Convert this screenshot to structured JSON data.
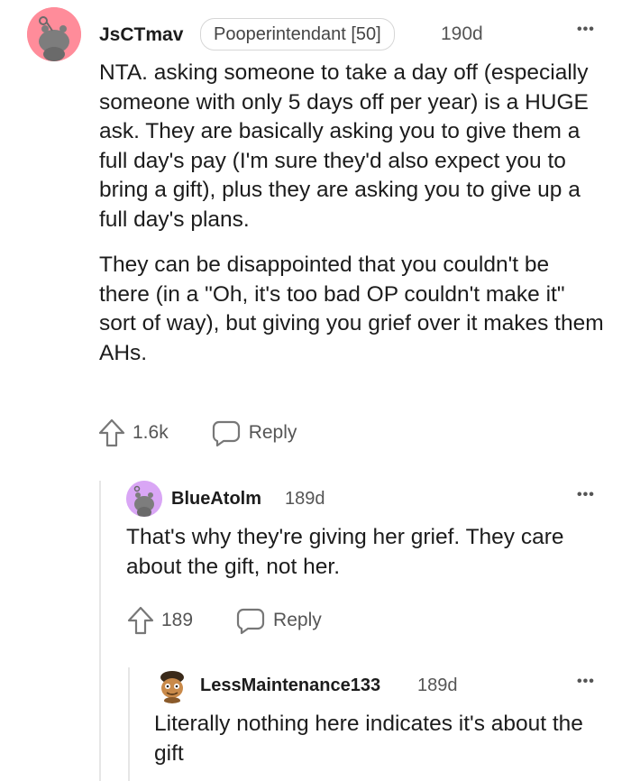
{
  "comments": [
    {
      "username": "JsCTmav",
      "flair": "Pooperintendant [50]",
      "time": "190d",
      "paragraphs": [
        "NTA. asking someone to take a day off (especially someone with only 5 days off per year) is a HUGE ask. They are basically asking you to give them a full day's pay (I'm sure they'd also expect you to bring a gift), plus they are asking you to give up a full day's plans.",
        "They can be disappointed that you couldn't be there (in a \"Oh, it's too bad OP couldn't make it\" sort of way), but giving you grief over it makes them AHs."
      ],
      "votes": "1.6k",
      "reply_label": "Reply",
      "more_label": "•••"
    },
    {
      "username": "BlueAtolm",
      "time": "189d",
      "paragraphs": [
        "That's why they're giving her grief. They care about the gift, not her."
      ],
      "votes": "189",
      "reply_label": "Reply",
      "more_label": "•••"
    },
    {
      "username": "LessMaintenance133",
      "time": "189d",
      "paragraphs": [
        "Literally nothing here indicates it's about the gift"
      ],
      "more_label": "•••"
    }
  ],
  "colors": {
    "avatar1_bg": "#ff8c9a",
    "avatar2_bg": "#d9a6f5",
    "thread_line": "#e6e6e6"
  }
}
